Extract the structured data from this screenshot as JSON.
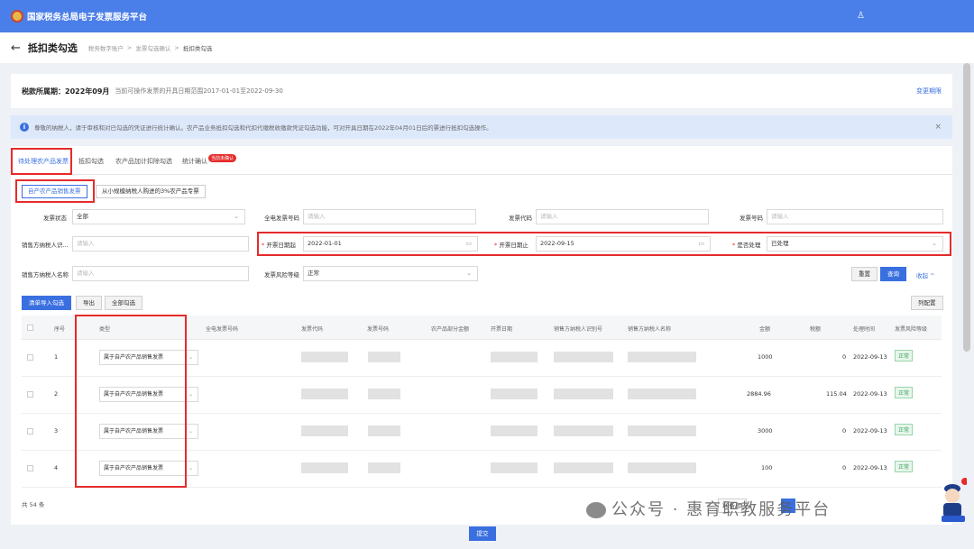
{
  "header": {
    "app_title": "国家税务总局电子发票服务平台",
    "user_icon": "user-icon"
  },
  "breadcrumb": {
    "back_icon": "←",
    "title": "抵扣类勾选",
    "items": [
      "税务数字账户",
      ">",
      "发票勾选确认",
      ">",
      "抵扣类勾选"
    ]
  },
  "period": {
    "label": "税款所属期：2022年09月",
    "note": "当前可操作发票的开具日期范围2017-01-01至2022-09-30",
    "link": "变更期限"
  },
  "notice": {
    "icon": "i",
    "text": "尊敬的纳税人，请于审核和对已勾选的凭证进行统计确认。农产品业务抵扣勾选和代扣代缴税收缴款凭证勾选功能，可对开具日期在2022年04月01日后的票进行抵扣勾选操作。",
    "close": "×"
  },
  "tabs": [
    {
      "label": "待处理农产品发票"
    },
    {
      "label": "抵扣勾选"
    },
    {
      "label": "农产品加计扣除勾选"
    },
    {
      "label": "统计确认",
      "badge": "当前未确认"
    }
  ],
  "subtabs": [
    {
      "label": "自产农产品销售发票"
    },
    {
      "label": "从小规模纳税人购进的3%农产品专票"
    }
  ],
  "filters": {
    "status_label": "发票状态",
    "status_value": "全部",
    "full_invoice_label": "全电发票号码",
    "full_invoice_placeholder": "请输入",
    "invoice_code_label": "发票代码",
    "invoice_code_placeholder": "请输入",
    "invoice_no_label": "发票号码",
    "invoice_no_placeholder": "请输入",
    "seller_id_label": "销售方纳税人识...",
    "seller_id_placeholder": "请输入",
    "date_start_label": "开票日期起",
    "date_start_value": "2022-01-01",
    "date_end_label": "开票日期止",
    "date_end_value": "2022-09-15",
    "processed_label": "是否处理",
    "processed_value": "已处理",
    "seller_name_label": "销售方纳税人名称",
    "seller_name_placeholder": "请输入",
    "risk_label": "发票风险等级",
    "risk_value": "正常",
    "reset": "重置",
    "query": "查询",
    "collapse": "收起 ^"
  },
  "actions": {
    "import_check": "清单导入勾选",
    "export": "导出",
    "check_all": "全部勾选",
    "columns": "列配置"
  },
  "table": {
    "headers": [
      "序号",
      "类型",
      "全电发票号码",
      "发票代码",
      "发票号码",
      "农产品部分金额",
      "开票日期",
      "销售方纳税人识别号",
      "销售方纳税人名称",
      "金额",
      "税额",
      "处理时间",
      "发票风险等级"
    ],
    "rows": [
      {
        "no": "1",
        "type": "属于自产农产品销售发票",
        "amount": "1000",
        "tax": "0",
        "time": "2022-09-13",
        "risk": "正常"
      },
      {
        "no": "2",
        "type": "属于自产农产品销售发票",
        "amount": "2884.96",
        "tax": "115.04",
        "time": "2022-09-13",
        "risk": "正常"
      },
      {
        "no": "3",
        "type": "属于自产农产品销售发票",
        "amount": "3000",
        "tax": "0",
        "time": "2022-09-13",
        "risk": "正常"
      },
      {
        "no": "4",
        "type": "属于自产农产品销售发票",
        "amount": "100",
        "tax": "0",
        "time": "2022-09-13",
        "risk": "正常"
      }
    ],
    "total": "共 54 条"
  },
  "pager": {
    "page_size": "10条/页"
  },
  "submit": "提交",
  "watermark": "公众号 · 惠育职教服务平台"
}
